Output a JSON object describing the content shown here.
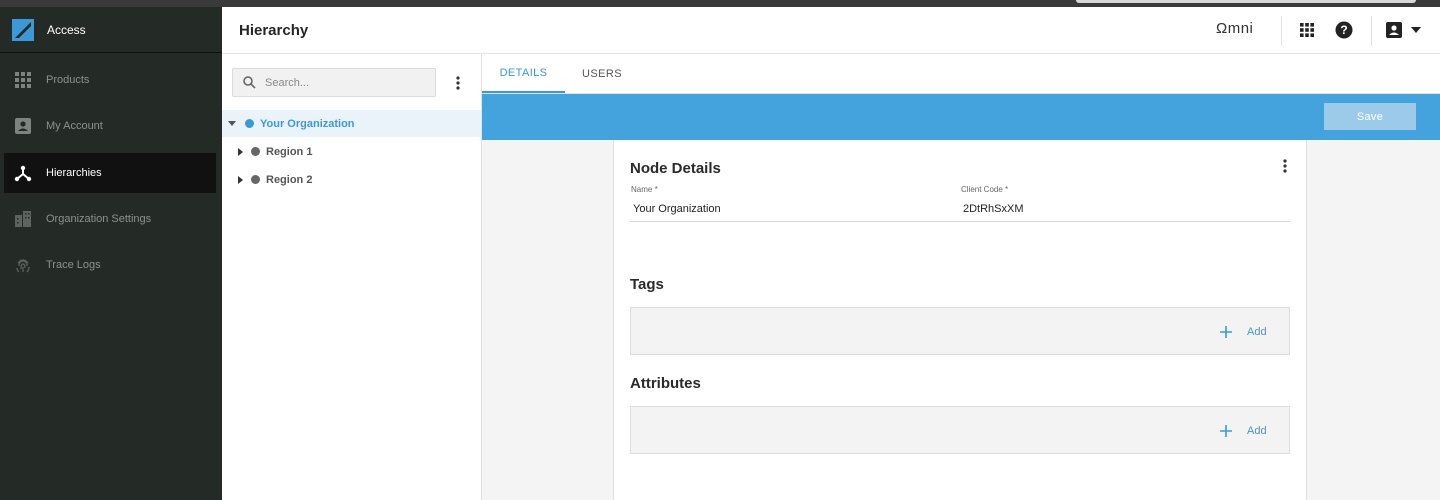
{
  "app": {
    "name": "Access",
    "page_title": "Hierarchy",
    "brand_right": "Ωmni"
  },
  "sidebar": {
    "items": [
      {
        "label": "Products",
        "icon": "grid-icon",
        "active": false
      },
      {
        "label": "My Account",
        "icon": "account-box-icon",
        "active": false
      },
      {
        "label": "Hierarchies",
        "icon": "hierarchy-icon",
        "active": true
      },
      {
        "label": "Organization Settings",
        "icon": "building-icon",
        "active": false
      },
      {
        "label": "Trace Logs",
        "icon": "fingerprint-icon",
        "active": false
      }
    ]
  },
  "header_icons": [
    "apps-grid-icon",
    "help-icon",
    "account-icon",
    "caret-down-icon"
  ],
  "tree": {
    "search_placeholder": "Search...",
    "nodes": [
      {
        "label": "Your Organization",
        "selected": true,
        "expanded": true
      },
      {
        "label": "Region 1",
        "selected": false,
        "expanded": false
      },
      {
        "label": "Region 2",
        "selected": false,
        "expanded": false
      }
    ]
  },
  "tabs": [
    {
      "label": "DETAILS",
      "active": true
    },
    {
      "label": "USERS",
      "active": false
    }
  ],
  "actionbar": {
    "save_label": "Save"
  },
  "node_details": {
    "title": "Node Details",
    "name_label": "Name *",
    "name_value": "Your Organization",
    "client_code_label": "Client Code *",
    "client_code_value": "2DtRhSxXM"
  },
  "tags": {
    "title": "Tags",
    "add_label": "Add"
  },
  "attributes": {
    "title": "Attributes",
    "add_label": "Add"
  },
  "colors": {
    "accent": "#44a2dd",
    "link": "#3b99d8",
    "sidebar_bg": "#242a26",
    "sidebar_active": "#111111"
  }
}
